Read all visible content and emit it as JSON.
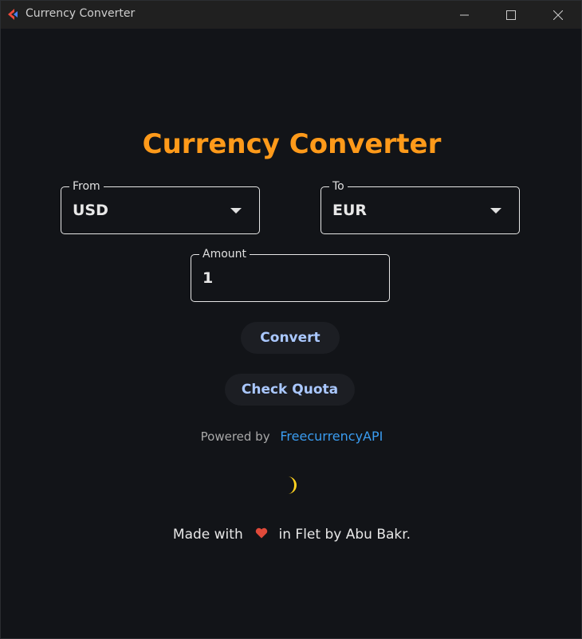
{
  "window": {
    "title": "Currency Converter"
  },
  "main": {
    "heading": "Currency Converter",
    "from": {
      "label": "From",
      "value": "USD"
    },
    "to": {
      "label": "To",
      "value": "EUR"
    },
    "amount": {
      "label": "Amount",
      "value": "1"
    },
    "convert_label": "Convert",
    "quota_label": "Check Quota",
    "powered_by": "Powered by",
    "api_name": "FreecurrencyAPI",
    "footer_before": "Made with",
    "footer_after": "in Flet by Abu Bakr."
  },
  "colors": {
    "accent": "#ff9a1a",
    "button_text": "#aac8ff",
    "link": "#3a9cf0",
    "heart": "#e04a3a",
    "moon": "#ffd21f"
  },
  "icons": {
    "app": "flet-logo-icon",
    "minimize": "minimize-icon",
    "maximize": "maximize-icon",
    "close": "close-icon",
    "dropdown": "dropdown-arrow-icon",
    "theme": "moon-icon",
    "heart": "heart-icon"
  }
}
